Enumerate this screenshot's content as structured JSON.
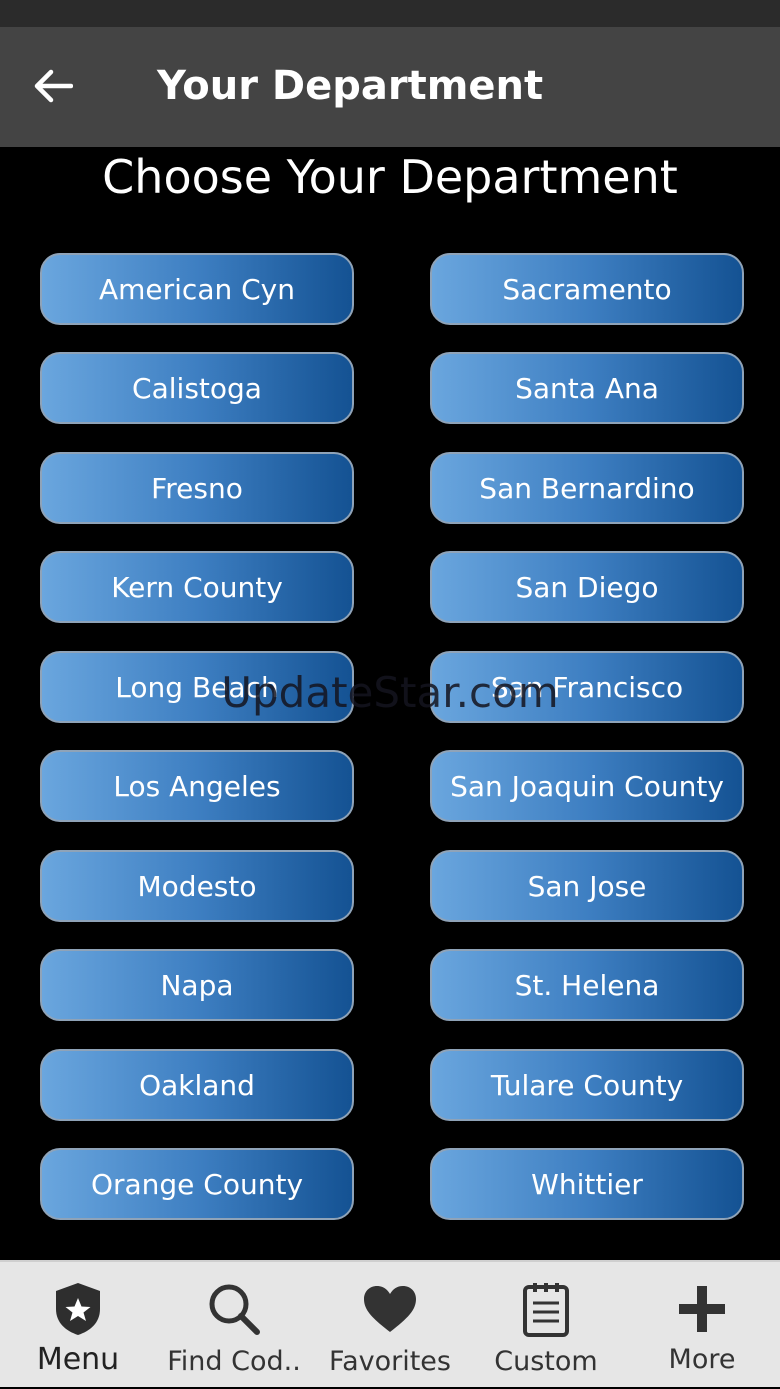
{
  "header": {
    "title": "Your Department",
    "back_icon": "arrow-left-icon"
  },
  "heading": "Choose Your Department",
  "departments_left": [
    "American Cyn",
    "Calistoga",
    "Fresno",
    "Kern County",
    "Long Beach",
    "Los Angeles",
    "Modesto",
    "Napa",
    "Oakland",
    "Orange County"
  ],
  "departments_right": [
    "Sacramento",
    "Santa Ana",
    "San Bernardino",
    "San Diego",
    "San Francisco",
    "San Joaquin County",
    "San Jose",
    "St. Helena",
    "Tulare County",
    "Whittier"
  ],
  "watermark": "UpdateStar.com",
  "colors": {
    "button_gradient_start": "#6aa6de",
    "button_gradient_end": "#145293",
    "app_bar": "#444444",
    "background": "#000000",
    "nav_background": "#e6e6e6"
  },
  "bottom_nav": [
    {
      "label": "Menu",
      "icon": "badge-star-icon",
      "active": true
    },
    {
      "label": "Find Cod..",
      "icon": "search-icon",
      "active": false
    },
    {
      "label": "Favorites",
      "icon": "heart-icon",
      "active": false
    },
    {
      "label": "Custom",
      "icon": "clipboard-icon",
      "active": false
    },
    {
      "label": "More",
      "icon": "plus-icon",
      "active": false
    }
  ]
}
